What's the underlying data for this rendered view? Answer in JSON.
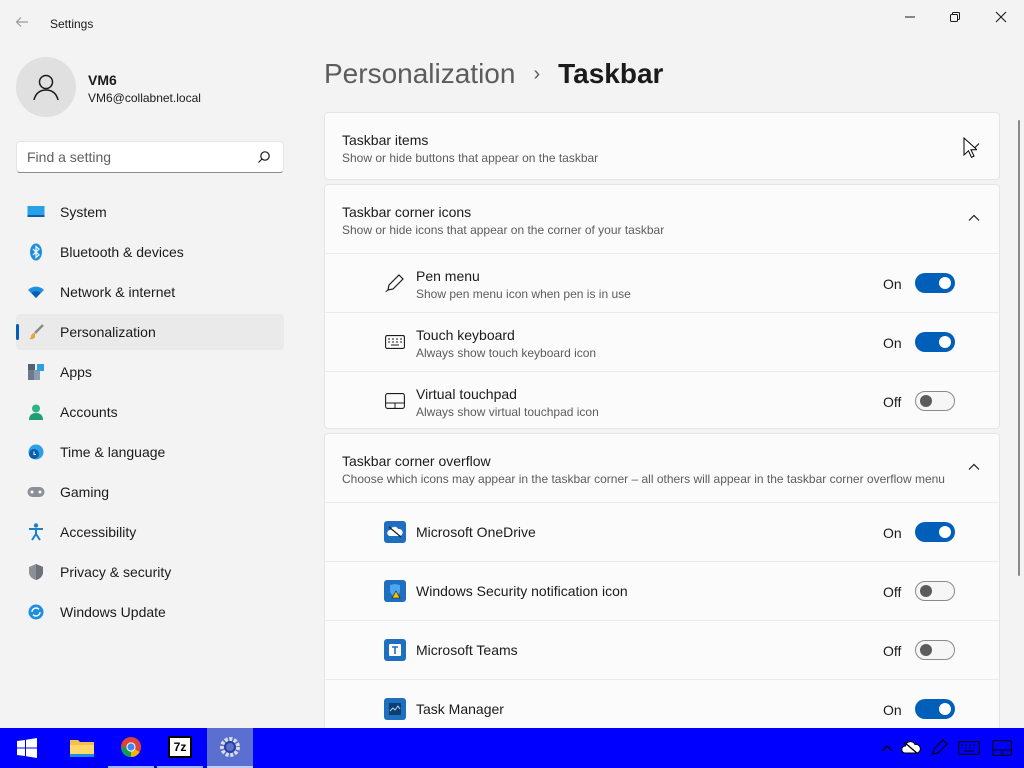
{
  "window": {
    "title": "Settings",
    "back_icon": "back-arrow-icon"
  },
  "user": {
    "name": "VM6",
    "email": "VM6@collabnet.local"
  },
  "search": {
    "placeholder": "Find a setting"
  },
  "sidebar": {
    "items": [
      {
        "label": "System",
        "icon": "system-icon",
        "active": false
      },
      {
        "label": "Bluetooth & devices",
        "icon": "bluetooth-icon",
        "active": false
      },
      {
        "label": "Network & internet",
        "icon": "wifi-icon",
        "active": false
      },
      {
        "label": "Personalization",
        "icon": "brush-icon",
        "active": true
      },
      {
        "label": "Apps",
        "icon": "apps-icon",
        "active": false
      },
      {
        "label": "Accounts",
        "icon": "accounts-icon",
        "active": false
      },
      {
        "label": "Time & language",
        "icon": "time-language-icon",
        "active": false
      },
      {
        "label": "Gaming",
        "icon": "gamepad-icon",
        "active": false
      },
      {
        "label": "Accessibility",
        "icon": "accessibility-icon",
        "active": false
      },
      {
        "label": "Privacy & security",
        "icon": "shield-icon",
        "active": false
      },
      {
        "label": "Windows Update",
        "icon": "windows-update-icon",
        "active": false
      }
    ]
  },
  "breadcrumb": {
    "parent": "Personalization",
    "separator": "›",
    "current": "Taskbar"
  },
  "sections": {
    "items": {
      "title": "Taskbar items",
      "subtitle": "Show or hide buttons that appear on the taskbar",
      "expanded": false
    },
    "corner_icons": {
      "title": "Taskbar corner icons",
      "subtitle": "Show or hide icons that appear on the corner of your taskbar",
      "expanded": true,
      "rows": [
        {
          "title": "Pen menu",
          "subtitle": "Show pen menu icon when pen is in use",
          "state": "On"
        },
        {
          "title": "Touch keyboard",
          "subtitle": "Always show touch keyboard icon",
          "state": "On"
        },
        {
          "title": "Virtual touchpad",
          "subtitle": "Always show virtual touchpad icon",
          "state": "Off"
        }
      ]
    },
    "corner_overflow": {
      "title": "Taskbar corner overflow",
      "subtitle": "Choose which icons may appear in the taskbar corner – all others will appear in the taskbar corner overflow menu",
      "expanded": true,
      "rows": [
        {
          "title": "Microsoft OneDrive",
          "state": "On"
        },
        {
          "title": "Windows Security notification icon",
          "state": "Off"
        },
        {
          "title": "Microsoft Teams",
          "state": "Off"
        },
        {
          "title": "Task Manager",
          "state": "On"
        }
      ]
    }
  },
  "taskbar": {
    "apps": [
      "start-icon",
      "file-explorer-icon",
      "chrome-icon",
      "7zip-icon",
      "settings-icon"
    ],
    "seven_zip_label": "7z",
    "tray": [
      "chevron-up-icon",
      "onedrive-icon",
      "pen-icon",
      "keyboard-icon",
      "touchpad-icon"
    ]
  },
  "colors": {
    "accent": "#005fb8",
    "taskbar": "#0000ff"
  }
}
